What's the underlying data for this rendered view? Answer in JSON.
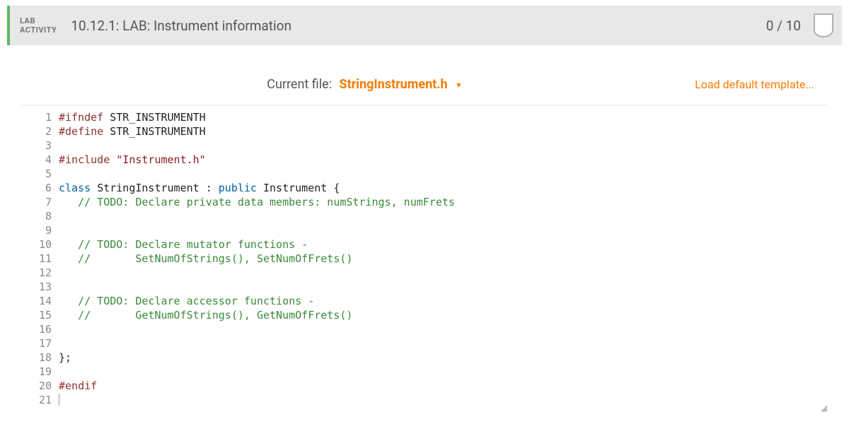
{
  "header": {
    "badge_line1": "LAB",
    "badge_line2": "ACTIVITY",
    "title": "10.12.1: LAB: Instrument information",
    "score": "0 / 10"
  },
  "editor": {
    "current_file_label": "Current file:",
    "current_file_name": "StringInstrument.h",
    "load_template": "Load default template...",
    "lines": [
      {
        "n": 1,
        "tokens": [
          {
            "c": "tok-pp",
            "t": "#ifndef"
          },
          {
            "c": "",
            "t": " "
          },
          {
            "c": "tok-mac",
            "t": "STR_INSTRUMENTH"
          }
        ]
      },
      {
        "n": 2,
        "tokens": [
          {
            "c": "tok-pp",
            "t": "#define"
          },
          {
            "c": "",
            "t": " "
          },
          {
            "c": "tok-mac",
            "t": "STR_INSTRUMENTH"
          }
        ]
      },
      {
        "n": 3,
        "tokens": []
      },
      {
        "n": 4,
        "tokens": [
          {
            "c": "tok-pp",
            "t": "#include"
          },
          {
            "c": "",
            "t": " "
          },
          {
            "c": "tok-str",
            "t": "\"Instrument.h\""
          }
        ]
      },
      {
        "n": 5,
        "tokens": []
      },
      {
        "n": 6,
        "tokens": [
          {
            "c": "tok-kw",
            "t": "class"
          },
          {
            "c": "",
            "t": " "
          },
          {
            "c": "tok-id",
            "t": "StringInstrument"
          },
          {
            "c": "",
            "t": " "
          },
          {
            "c": "tok-punc",
            "t": ":"
          },
          {
            "c": "",
            "t": " "
          },
          {
            "c": "tok-kw",
            "t": "public"
          },
          {
            "c": "",
            "t": " "
          },
          {
            "c": "tok-id",
            "t": "Instrument"
          },
          {
            "c": "",
            "t": " "
          },
          {
            "c": "tok-punc",
            "t": "{"
          }
        ]
      },
      {
        "n": 7,
        "tokens": [
          {
            "c": "",
            "t": "   "
          },
          {
            "c": "tok-cm",
            "t": "// TODO: Declare private data members: numStrings, numFrets"
          }
        ]
      },
      {
        "n": 8,
        "tokens": []
      },
      {
        "n": 9,
        "tokens": []
      },
      {
        "n": 10,
        "tokens": [
          {
            "c": "",
            "t": "   "
          },
          {
            "c": "tok-cm",
            "t": "// TODO: Declare mutator functions -"
          }
        ]
      },
      {
        "n": 11,
        "tokens": [
          {
            "c": "",
            "t": "   "
          },
          {
            "c": "tok-cm",
            "t": "//       SetNumOfStrings(), SetNumOfFrets()"
          }
        ]
      },
      {
        "n": 12,
        "tokens": []
      },
      {
        "n": 13,
        "tokens": []
      },
      {
        "n": 14,
        "tokens": [
          {
            "c": "",
            "t": "   "
          },
          {
            "c": "tok-cm",
            "t": "// TODO: Declare accessor functions -"
          }
        ]
      },
      {
        "n": 15,
        "tokens": [
          {
            "c": "",
            "t": "   "
          },
          {
            "c": "tok-cm",
            "t": "//       GetNumOfStrings(), GetNumOfFrets()"
          }
        ]
      },
      {
        "n": 16,
        "tokens": []
      },
      {
        "n": 17,
        "tokens": []
      },
      {
        "n": 18,
        "tokens": [
          {
            "c": "tok-punc",
            "t": "};"
          }
        ]
      },
      {
        "n": 19,
        "tokens": []
      },
      {
        "n": 20,
        "tokens": [
          {
            "c": "tok-pp",
            "t": "#endif"
          }
        ]
      },
      {
        "n": 21,
        "tokens": [],
        "cursor": true
      }
    ]
  }
}
